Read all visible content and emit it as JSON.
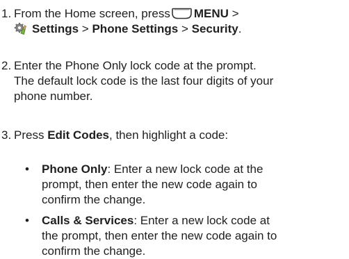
{
  "step1": {
    "number": "1.",
    "intro": "From the Home screen, press",
    "menu_label": "MENU",
    "sep1": ">",
    "settings_label": "Settings",
    "sep2": ">",
    "phone_settings_label": "Phone Settings",
    "sep3": ">",
    "security_label": "Security",
    "end": ".",
    "menu_key_icon": "menu-softkey-icon",
    "settings_icon": "settings-gear-icon"
  },
  "step2": {
    "number": "2.",
    "line1": "Enter the Phone Only lock code at the prompt.",
    "line2": "The default lock code is the last four digits of your",
    "line3": "phone number."
  },
  "step3": {
    "number": "3.",
    "press": "Press",
    "edit_codes": "Edit Codes",
    "rest": ", then highlight a code:"
  },
  "bullets": [
    {
      "dot": "•",
      "term": "Phone Only",
      "line1_rest": ": Enter a new lock code at the",
      "line2": "prompt, then enter the new code again to",
      "line3": "confirm the change."
    },
    {
      "dot": "•",
      "term": "Calls & Services",
      "line1_rest": ": Enter a new lock code at",
      "line2": "the prompt, then enter the new code again to",
      "line3": "confirm the change."
    }
  ],
  "colors": {
    "text": "#1f1f1f",
    "key_fill": "#ffffff",
    "key_outline": "#333333",
    "icon_gray": "#7a7a7a",
    "icon_green": "#7cb342"
  }
}
